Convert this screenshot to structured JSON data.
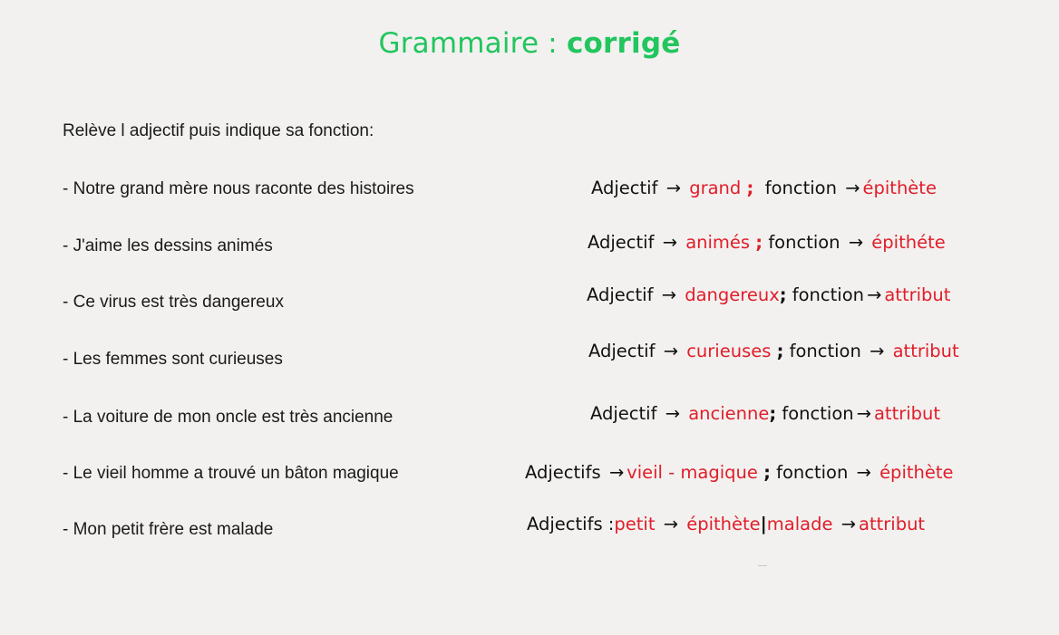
{
  "title": {
    "regular": "Grammaire : ",
    "bold": "corrigé"
  },
  "instruction": "Relève l adjectif puis indique sa fonction:",
  "rows": [
    {
      "sentence": "- Notre grand mère nous raconte des histoires",
      "adj_label": "Adjectif",
      "arrow": "→",
      "adjective": "grand",
      "semicolon": ";",
      "fonction_label": "fonction",
      "fonction": "épithète"
    },
    {
      "sentence": "- J'aime les dessins animés",
      "adj_label": "Adjectif",
      "arrow": "→",
      "adjective": "animés",
      "semicolon": ";",
      "fonction_label": "fonction",
      "fonction": "épithéte"
    },
    {
      "sentence": "- Ce virus est très dangereux",
      "adj_label": "Adjectif",
      "arrow": "→",
      "adjective": "dangereux",
      "semicolon": ";",
      "fonction_label": "fonction",
      "fonction": "attribut"
    },
    {
      "sentence": "- Les femmes sont curieuses",
      "adj_label": "Adjectif",
      "arrow": "→",
      "adjective": "curieuses",
      "semicolon": ";",
      "fonction_label": "fonction",
      "fonction": "attribut"
    },
    {
      "sentence": "- La voiture de mon oncle est très ancienne",
      "adj_label": "Adjectif",
      "arrow": "→",
      "adjective": "ancienne",
      "semicolon": ";",
      "fonction_label": "fonction",
      "fonction": "attribut"
    },
    {
      "sentence": "- Le vieil homme a trouvé un bâton magique",
      "adj_label": "Adjectifs",
      "arrow": "→",
      "adjective": "vieil - magique",
      "semicolon": ";",
      "fonction_label": "fonction",
      "fonction": "épithète"
    },
    {
      "sentence": "- Mon petit frère est malade",
      "adj_label": "Adjectifs :",
      "arrow": "→",
      "adjective_1": "petit",
      "fonction_1": "épithète",
      "separator": "|",
      "adjective_2": "malade",
      "fonction_2": "attribut"
    }
  ],
  "colors": {
    "title": "#22c55e",
    "answer": "#e11d2a",
    "text": "#1a1a1a"
  }
}
